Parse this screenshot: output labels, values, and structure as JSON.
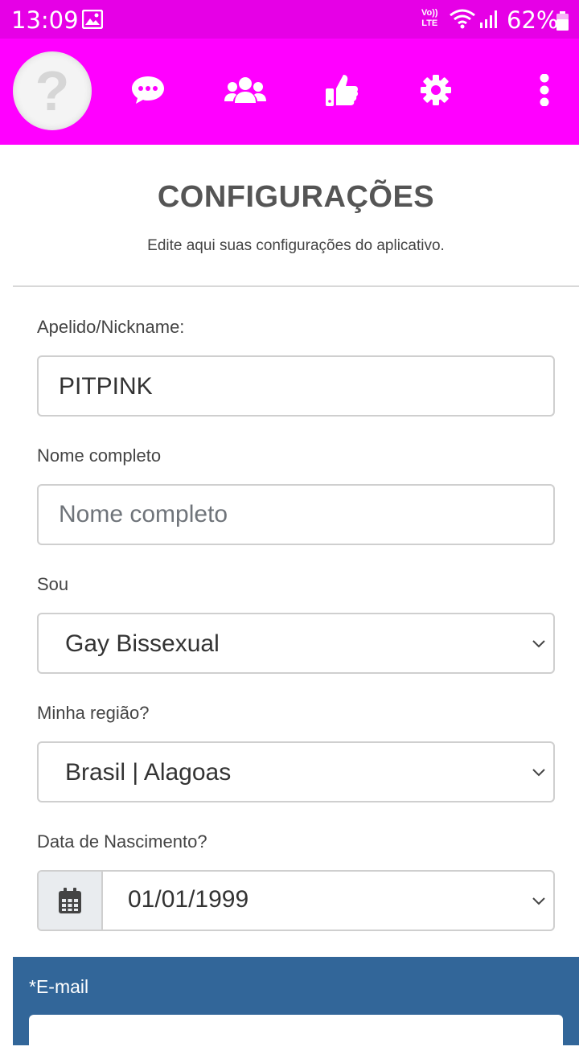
{
  "status_bar": {
    "time": "13:09",
    "network_label_top": "Vo))",
    "network_label_bottom": "LTE",
    "battery": "62%",
    "icons": [
      "image-icon",
      "wifi-icon",
      "signal-icon",
      "battery-icon"
    ]
  },
  "nav": {
    "avatar_symbol": "?",
    "icons": [
      "chat-icon",
      "users-icon",
      "thumbs-up-icon",
      "gear-icon",
      "more-vertical-icon"
    ]
  },
  "page": {
    "title": "CONFIGURAÇÕES",
    "subtitle": "Edite aqui suas configurações do aplicativo."
  },
  "form": {
    "nickname": {
      "label": "Apelido/Nickname:",
      "value": "PITPINK"
    },
    "full_name": {
      "label": "Nome completo",
      "value": "",
      "placeholder": "Nome completo"
    },
    "sou": {
      "label": "Sou",
      "value": "Gay Bissexual"
    },
    "region": {
      "label": "Minha região?",
      "value": "Brasil | Alagoas"
    },
    "birth_date": {
      "label": "Data de Nascimento?",
      "value": "01/01/1999",
      "icon": "calendar-icon"
    },
    "email": {
      "label": "*E-mail"
    }
  },
  "colors": {
    "status_bar": "#e600e6",
    "nav_bar": "#ff00ff",
    "email_panel": "#326699"
  }
}
